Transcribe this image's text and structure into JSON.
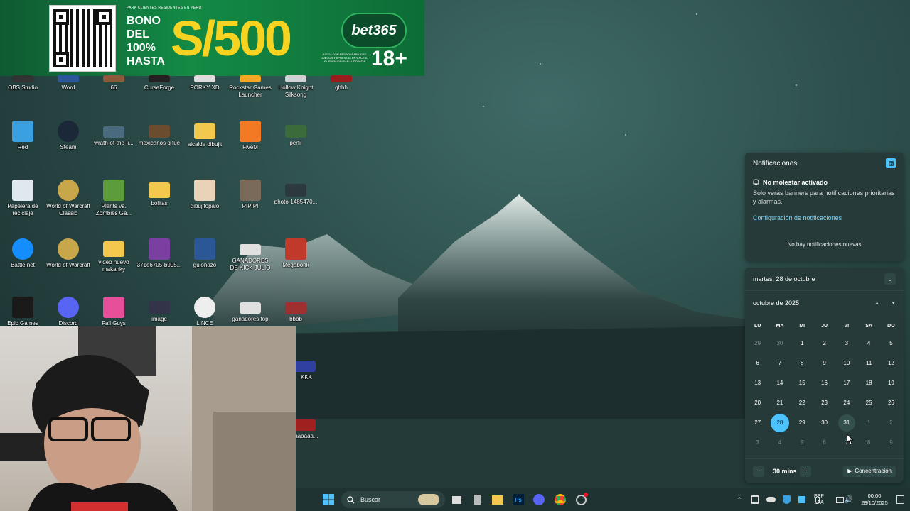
{
  "ad": {
    "small_text": "PARA CLIENTES RESIDENTES EN PERU",
    "bono_text": "BONO DEL 100% HASTA",
    "amount": "S/500",
    "brand": "bet365",
    "fine_print": "JUEGA CON RESPONSABILIDAD. JUEGOS Y APUESTAS EN EXCESO PUEDEN CAUSAR LUDOPATIA",
    "age": "18+"
  },
  "desktop": {
    "row1": [
      "OBS Studio",
      "Word",
      "66",
      "CurseForge",
      "PORKY XD",
      "Rockstar Games Launcher",
      "Hollow Knight Silksong",
      "ghhh"
    ],
    "row2": [
      "Red",
      "Steam",
      "wrath-of-the-li...",
      "mexicanos q fue",
      "alcalde dibujit",
      "FiveM",
      "perfil"
    ],
    "row3": [
      "Papelera de reciclaje",
      "World of Warcraft Classic",
      "Plants vs. Zombies Ga...",
      "bolitas",
      "dibujitopalo",
      "PIPIPI",
      "photo-1485470..."
    ],
    "row4": [
      "Battle.net",
      "World of Warcraft",
      "video nuevo makanky",
      "371e6705-b995...",
      "guionazo",
      "GANADORES DE KICK JULIO",
      "Megabonk"
    ],
    "row5": [
      "Epic Games",
      "Discord",
      "Fall Guys",
      "image",
      "LINCE",
      "ganadores top",
      "bbbb"
    ],
    "partial": [
      "KKK",
      "aaaaaa..."
    ]
  },
  "notifications": {
    "title": "Notificaciones",
    "dnd_title": "No molestar activado",
    "dnd_desc": "Solo verás banners para notificaciones prioritarias y alarmas.",
    "settings_link": "Configuración de notificaciones",
    "empty": "No hay notificaciones nuevas"
  },
  "calendar": {
    "date_header": "martes, 28 de octubre",
    "month_label": "octubre de 2025",
    "weekdays": [
      "LU",
      "MA",
      "MI",
      "JU",
      "VI",
      "SA",
      "DO"
    ],
    "days": [
      {
        "n": "29",
        "t": "other"
      },
      {
        "n": "30",
        "t": "other"
      },
      {
        "n": "1",
        "t": "cur"
      },
      {
        "n": "2",
        "t": "cur"
      },
      {
        "n": "3",
        "t": "cur"
      },
      {
        "n": "4",
        "t": "cur"
      },
      {
        "n": "5",
        "t": "cur"
      },
      {
        "n": "6",
        "t": "cur"
      },
      {
        "n": "7",
        "t": "cur"
      },
      {
        "n": "8",
        "t": "cur"
      },
      {
        "n": "9",
        "t": "cur"
      },
      {
        "n": "10",
        "t": "cur"
      },
      {
        "n": "11",
        "t": "cur"
      },
      {
        "n": "12",
        "t": "cur"
      },
      {
        "n": "13",
        "t": "cur"
      },
      {
        "n": "14",
        "t": "cur"
      },
      {
        "n": "15",
        "t": "cur"
      },
      {
        "n": "16",
        "t": "cur"
      },
      {
        "n": "17",
        "t": "cur"
      },
      {
        "n": "18",
        "t": "cur"
      },
      {
        "n": "19",
        "t": "cur"
      },
      {
        "n": "20",
        "t": "cur"
      },
      {
        "n": "21",
        "t": "cur"
      },
      {
        "n": "22",
        "t": "cur"
      },
      {
        "n": "23",
        "t": "cur"
      },
      {
        "n": "24",
        "t": "cur"
      },
      {
        "n": "25",
        "t": "cur"
      },
      {
        "n": "26",
        "t": "cur"
      },
      {
        "n": "27",
        "t": "cur"
      },
      {
        "n": "28",
        "t": "today"
      },
      {
        "n": "29",
        "t": "cur"
      },
      {
        "n": "30",
        "t": "cur"
      },
      {
        "n": "31",
        "t": "hover"
      },
      {
        "n": "1",
        "t": "other"
      },
      {
        "n": "2",
        "t": "other"
      },
      {
        "n": "3",
        "t": "other"
      },
      {
        "n": "4",
        "t": "other"
      },
      {
        "n": "5",
        "t": "other"
      },
      {
        "n": "6",
        "t": "other"
      },
      {
        "n": "7",
        "t": "other"
      },
      {
        "n": "8",
        "t": "other"
      },
      {
        "n": "9",
        "t": "other"
      }
    ],
    "focus_duration": "30 mins",
    "focus_start_label": "Concentración"
  },
  "taskbar": {
    "search_placeholder": "Buscar",
    "lang_top": "ESP",
    "lang_bottom": "LAA",
    "time": "00:00",
    "date": "28/10/2025"
  },
  "colors": {
    "accent": "#4cc2ff",
    "panel_bg": "#253a39",
    "taskbar_bg": "#1f3332"
  }
}
